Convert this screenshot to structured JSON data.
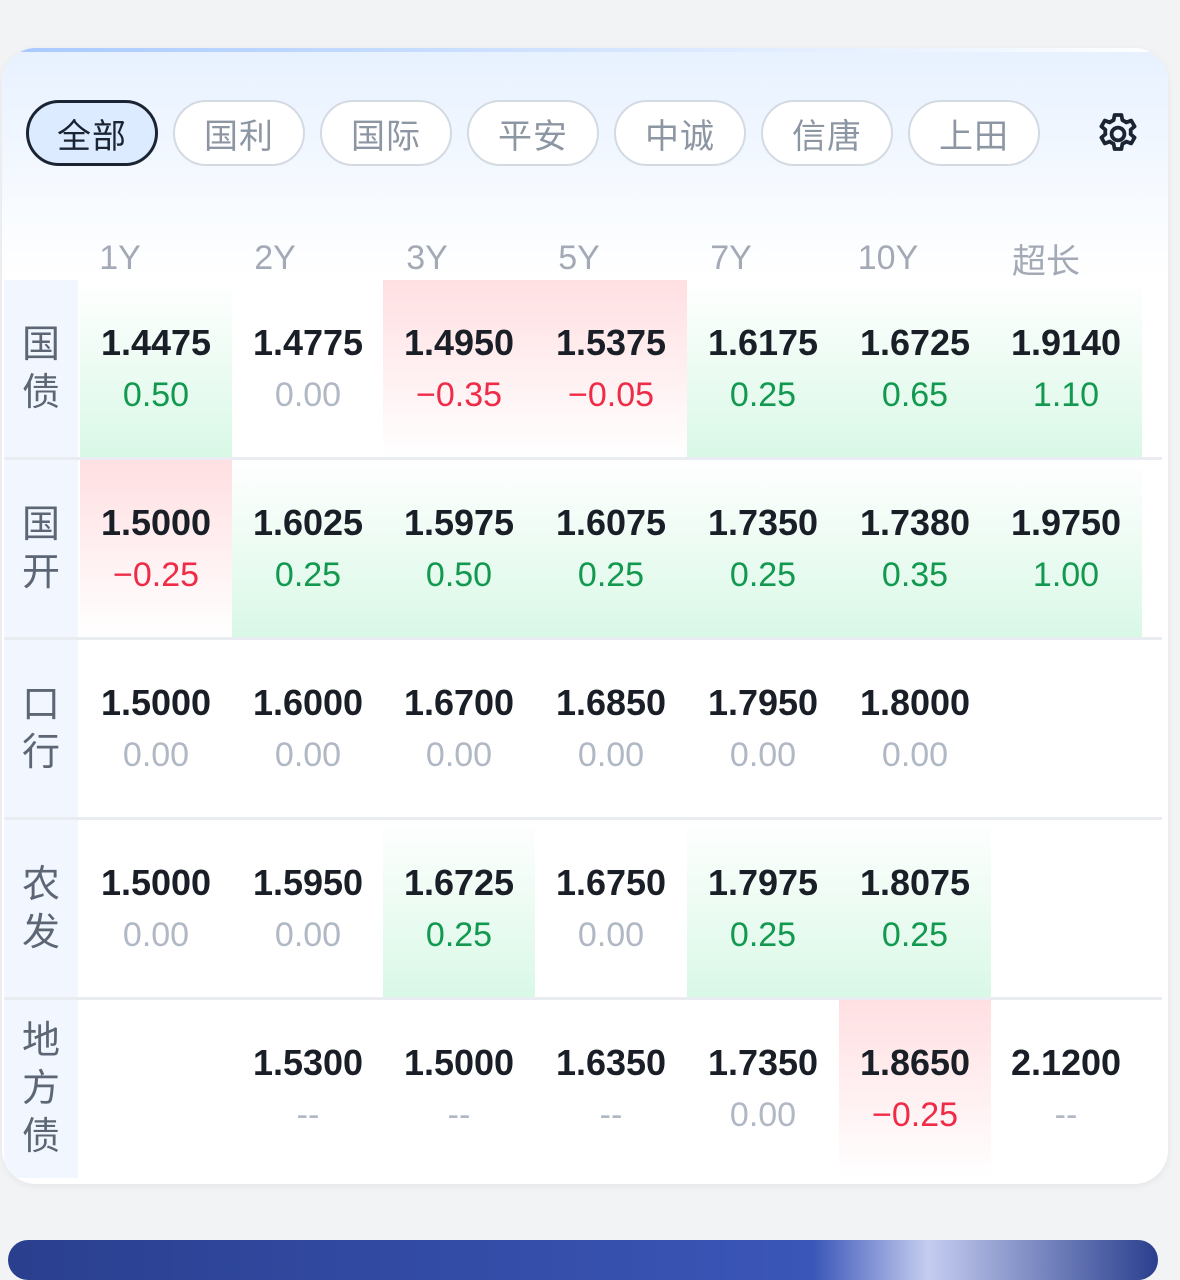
{
  "tabs": [
    "全部",
    "国利",
    "国际",
    "平安",
    "中诚",
    "信唐",
    "上田"
  ],
  "active_tab": 0,
  "settings_icon": "gear-icon",
  "columns": [
    "1Y",
    "2Y",
    "3Y",
    "5Y",
    "7Y",
    "10Y",
    "超长"
  ],
  "rows": [
    {
      "label": "国债",
      "cells": [
        {
          "v": "1.4475",
          "c": "0.50",
          "t": "up"
        },
        {
          "v": "1.4775",
          "c": "0.00",
          "t": "flat"
        },
        {
          "v": "1.4950",
          "c": "−0.35",
          "t": "down"
        },
        {
          "v": "1.5375",
          "c": "−0.05",
          "t": "down"
        },
        {
          "v": "1.6175",
          "c": "0.25",
          "t": "up"
        },
        {
          "v": "1.6725",
          "c": "0.65",
          "t": "up"
        },
        {
          "v": "1.9140",
          "c": "1.10",
          "t": "up"
        }
      ]
    },
    {
      "label": "国开",
      "cells": [
        {
          "v": "1.5000",
          "c": "−0.25",
          "t": "down"
        },
        {
          "v": "1.6025",
          "c": "0.25",
          "t": "up"
        },
        {
          "v": "1.5975",
          "c": "0.50",
          "t": "up"
        },
        {
          "v": "1.6075",
          "c": "0.25",
          "t": "up"
        },
        {
          "v": "1.7350",
          "c": "0.25",
          "t": "up"
        },
        {
          "v": "1.7380",
          "c": "0.35",
          "t": "up"
        },
        {
          "v": "1.9750",
          "c": "1.00",
          "t": "up"
        }
      ]
    },
    {
      "label": "口行",
      "cells": [
        {
          "v": "1.5000",
          "c": "0.00",
          "t": "flat"
        },
        {
          "v": "1.6000",
          "c": "0.00",
          "t": "flat"
        },
        {
          "v": "1.6700",
          "c": "0.00",
          "t": "flat"
        },
        {
          "v": "1.6850",
          "c": "0.00",
          "t": "flat"
        },
        {
          "v": "1.7950",
          "c": "0.00",
          "t": "flat"
        },
        {
          "v": "1.8000",
          "c": "0.00",
          "t": "flat"
        },
        {
          "v": "",
          "c": "",
          "t": "empty"
        }
      ]
    },
    {
      "label": "农发",
      "cells": [
        {
          "v": "1.5000",
          "c": "0.00",
          "t": "flat"
        },
        {
          "v": "1.5950",
          "c": "0.00",
          "t": "flat"
        },
        {
          "v": "1.6725",
          "c": "0.25",
          "t": "up"
        },
        {
          "v": "1.6750",
          "c": "0.00",
          "t": "flat"
        },
        {
          "v": "1.7975",
          "c": "0.25",
          "t": "up"
        },
        {
          "v": "1.8075",
          "c": "0.25",
          "t": "up"
        },
        {
          "v": "",
          "c": "",
          "t": "empty"
        }
      ]
    },
    {
      "label": "地方债",
      "cells": [
        {
          "v": "",
          "c": "",
          "t": "empty"
        },
        {
          "v": "1.5300",
          "c": "--",
          "t": "flat"
        },
        {
          "v": "1.5000",
          "c": "--",
          "t": "flat"
        },
        {
          "v": "1.6350",
          "c": "--",
          "t": "flat"
        },
        {
          "v": "1.7350",
          "c": "0.00",
          "t": "flat"
        },
        {
          "v": "1.8650",
          "c": "−0.25",
          "t": "down"
        },
        {
          "v": "2.1200",
          "c": "--",
          "t": "flat"
        }
      ]
    }
  ]
}
